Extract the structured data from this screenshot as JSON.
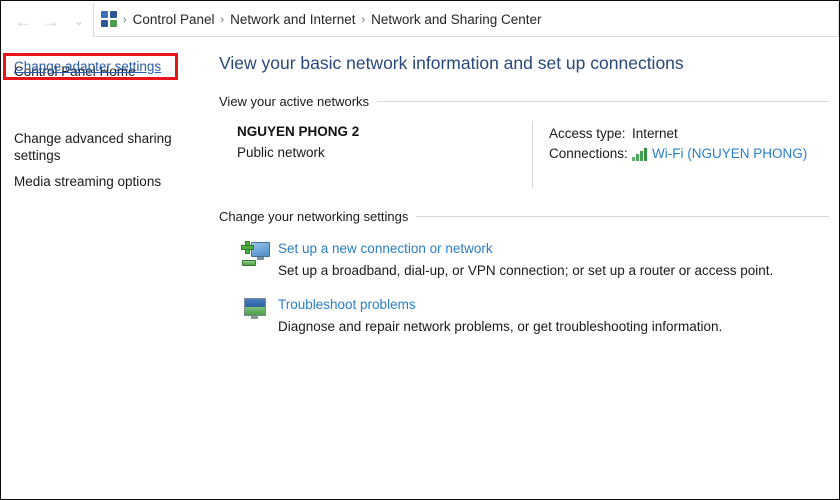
{
  "navigation": {
    "back_icon": "arrow-left-icon",
    "back_enabled": false,
    "forward_icon": "arrow-right-icon",
    "forward_enabled": false,
    "recent_icon": "chevron-down-icon",
    "up_icon": "arrow-up-icon",
    "address_icon": "control-panel-icon",
    "separator": "›",
    "breadcrumbs": [
      {
        "label": "Control Panel"
      },
      {
        "label": "Network and Internet"
      },
      {
        "label": "Network and Sharing Center"
      }
    ]
  },
  "sidebar": {
    "home_label": "Control Panel Home",
    "links": [
      {
        "label": "Change adapter settings",
        "highlighted": true
      },
      {
        "label": "Change advanced sharing settings",
        "highlighted": false
      },
      {
        "label": "Media streaming options",
        "highlighted": false
      }
    ]
  },
  "main": {
    "page_title": "View your basic network information and set up connections",
    "active_networks": {
      "section_label": "View your active networks",
      "network_name": "NGUYEN PHONG 2",
      "network_type": "Public network",
      "details": [
        {
          "key": "Access type:",
          "value": "Internet",
          "is_link": false,
          "icon": ""
        },
        {
          "key": "Connections:",
          "value": "Wi-Fi (NGUYEN PHONG)",
          "is_link": true,
          "icon": "wifi-signal-icon"
        }
      ]
    },
    "networking_settings": {
      "section_label": "Change your networking settings",
      "tasks": [
        {
          "icon": "new-connection-icon",
          "link": "Set up a new connection or network",
          "description": "Set up a broadband, dial-up, or VPN connection; or set up a router or access point."
        },
        {
          "icon": "troubleshoot-icon",
          "link": "Troubleshoot problems",
          "description": "Diagnose and repair network problems, or get troubleshooting information."
        }
      ]
    }
  },
  "colors": {
    "heading": "#29487d",
    "link": "#2a7fc9",
    "sidebar_link": "#2a5db0",
    "highlight_border": "#e8141c",
    "wifi_green": "#3f9e4d"
  }
}
